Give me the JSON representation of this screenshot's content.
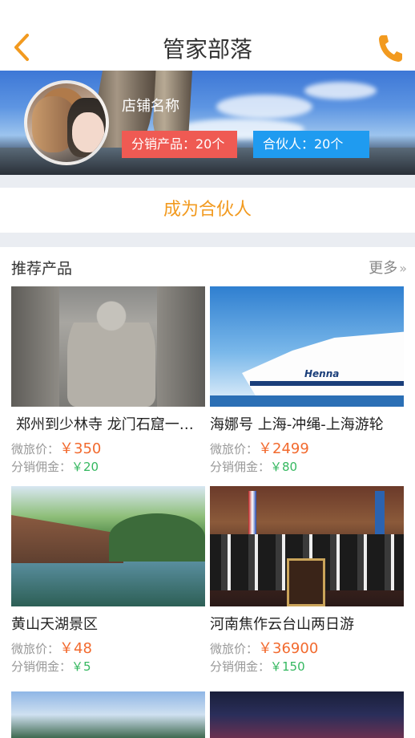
{
  "header": {
    "title": "管家部落",
    "back_icon": "chevron-left-icon",
    "phone_icon": "phone-icon",
    "accent_color": "#f29a1f"
  },
  "banner": {
    "shop_name": "店铺名称",
    "products_badge": "分销产品：20个",
    "partners_badge": "合伙人：20个"
  },
  "cta": {
    "label": "成为合伙人"
  },
  "section": {
    "title": "推荐产品",
    "more": "更多"
  },
  "labels": {
    "price": "微旅价：",
    "commission": "分销佣金："
  },
  "products": [
    {
      "name": "郑州到少林寺 龙门石窟一日游",
      "price": "￥350",
      "commission": "￥20",
      "image": "longmen-buddha"
    },
    {
      "name": "海娜号 上海-冲绳-上海游轮",
      "price": "￥2499",
      "commission": "￥80",
      "image": "cruise-ship-henna"
    },
    {
      "name": "黄山天湖景区",
      "price": "￥48",
      "commission": "￥5",
      "image": "lake-landscape"
    },
    {
      "name": "河南焦作云台山两日游",
      "price": "￥36900",
      "commission": "￥150",
      "image": "conference-group"
    }
  ],
  "ship_text": "Henna"
}
